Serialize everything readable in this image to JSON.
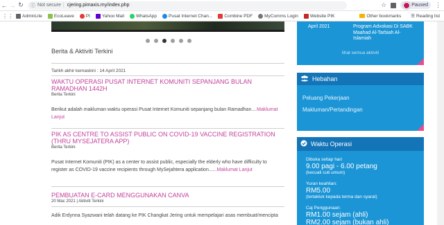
{
  "browser": {
    "security": "Not secure",
    "url": "cjering.pimaxis.my/index.php",
    "profile_status": "Paused"
  },
  "bookmarks": {
    "items": [
      {
        "label": "AdminLite",
        "color": "#5f6368"
      },
      {
        "label": "EcoLeave",
        "color": "#8bc34a"
      },
      {
        "label": "PI",
        "color": "#e53935"
      },
      {
        "label": "Yahoo Mail",
        "color": "#6001d2"
      },
      {
        "label": "WhatsApp",
        "color": "#25d366"
      },
      {
        "label": "Pusat Internet Chan...",
        "color": "#1e88e5"
      },
      {
        "label": "Combine PDF",
        "color": "#e53935"
      },
      {
        "label": "MyComms Login",
        "color": "#757575"
      },
      {
        "label": "Website PIK",
        "color": "#c62828"
      }
    ],
    "other_label": "Other bookmarks",
    "reading_label": "Reading list"
  },
  "main": {
    "section_title": "Berita & Aktiviti Terkini",
    "updated": "Tarikh akhir kemaskini : 14 April 2021",
    "more_label": "Maklumat Lanjut",
    "news": [
      {
        "title": "WAKTU OPERASI PUSAT INTERNET KOMUNITI SEPANJANG BULAN RAMADHAN 1442H",
        "meta": "Berita Terkini",
        "body": "Berikut adalah makluman waktu operasi Pusat Internet Komuniti sepanjang bulan Ramadhan....",
        "more": "Maklumat Lanjut"
      },
      {
        "title": "PIK AS CENTRE TO ASSIST PUBLIC ON COVID-19 VACCINE REGISTRATION (THRU MYSEJATERA APP)",
        "meta": "Berita Terkini",
        "body": "Pusat Internet Komuniti (PIK) as a center to assist public, especially the elderly who have difficulty to register as COVID-19 vaccine recipients through MySejahtera application......",
        "more": "Maklumat Lanjut"
      },
      {
        "title": "PEMBUATAN E-CARD MENGGUNAKAN CANVA",
        "meta": "20 Mac 2021 | Aktiviti Terkini",
        "body": "Adik Erdynna Syazwani telah datang ke PIK Changkat Jering untuk mempelajari asas membuat/mencipta"
      }
    ]
  },
  "sidebar": {
    "activity": {
      "date": "April 2021",
      "desc": "Program Advokasi Di SABK Maahad Al-Tarbiah Al-Islamiah",
      "all_link": "lihat semua aktiviti"
    },
    "hebahan": {
      "title": "Hebahan",
      "links": [
        "Peluang Pekerjaan",
        "Makluman/Pertandingan"
      ]
    },
    "waktu": {
      "title": "Waktu Operasi",
      "open_label": "Dibuka setiap hari",
      "open_time": "9.00 pagi - 6.00 petang",
      "open_note": "(kecuali cuti umum)",
      "fee_label": "Yuran keahlian:",
      "fee_value": "RM5.00",
      "fee_note": "(tertakluk kepada terma dan syarat)",
      "use_label": "Caj Penggunaan:",
      "use_adult": "RM1.00 sejam (ahli)",
      "use_non": "RM2.00 sejam (bukan ahli)"
    }
  }
}
